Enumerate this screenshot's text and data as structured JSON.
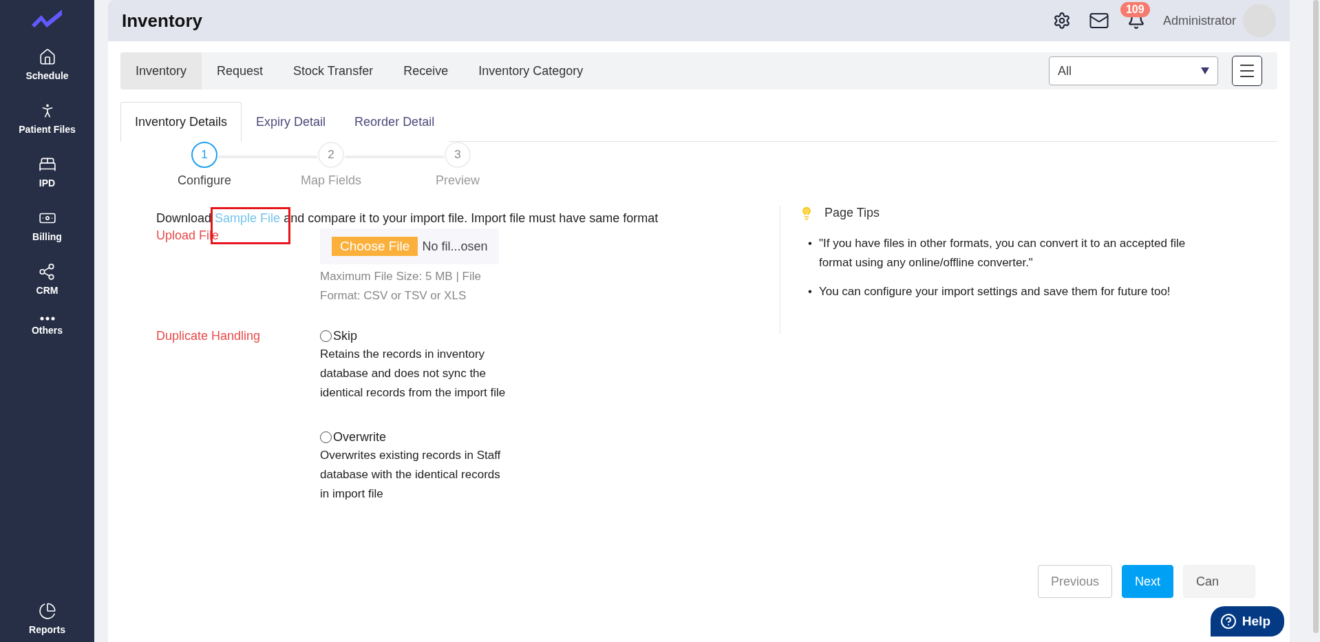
{
  "sidebar": {
    "items": [
      {
        "label": "Schedule",
        "kind": "home"
      },
      {
        "label": "Patient Files",
        "kind": "person"
      },
      {
        "label": "IPD",
        "kind": "bed"
      },
      {
        "label": "Billing",
        "kind": "cash"
      },
      {
        "label": "CRM",
        "kind": "network"
      },
      {
        "label": "Others",
        "kind": "dots"
      }
    ],
    "footer": {
      "label": "Reports",
      "kind": "pie"
    }
  },
  "header": {
    "title": "Inventory",
    "notification_count": "109",
    "user": "Administrator"
  },
  "tabs": [
    {
      "label": "Inventory",
      "selected": true
    },
    {
      "label": "Request",
      "selected": false
    },
    {
      "label": "Stock Transfer",
      "selected": false
    },
    {
      "label": "Receive",
      "selected": false
    },
    {
      "label": "Inventory Category",
      "selected": false
    }
  ],
  "filter": {
    "value": "All"
  },
  "subtabs": [
    {
      "label": "Inventory Details",
      "selected": true
    },
    {
      "label": "Expiry Detail",
      "selected": false
    },
    {
      "label": "Reorder Detail",
      "selected": false
    }
  ],
  "steps": [
    {
      "number": "1",
      "label": "Configure",
      "selected": true
    },
    {
      "number": "2",
      "label": "Map Fields",
      "selected": false
    },
    {
      "number": "3",
      "label": "Preview",
      "selected": false
    }
  ],
  "download": {
    "before": "Download",
    "link": "Sample File",
    "after": "and compare it to your import file. Import file must have same format",
    "highlighted": true
  },
  "upload": {
    "label": "Upload File",
    "button": "Choose File",
    "status": "No fil...osen",
    "hint": "Maximum File Size: 5 MB | File Format: CSV or TSV or XLS"
  },
  "duplicate": {
    "label": "Duplicate Handling",
    "options": [
      {
        "label": "Skip",
        "description": "Retains the records in inventory database and does not sync the identical records from the import file",
        "selected": false
      },
      {
        "label": "Overwrite",
        "description": "Overwrites existing records in Staff database with the identical records in import file",
        "selected": false
      }
    ]
  },
  "tips": {
    "title": "Page Tips",
    "marker": "•",
    "items": [
      "\"If you have files in other formats, you can convert it to an accepted file format using any online/offline converter.\"",
      "You can configure your import settings and save them for future too!"
    ]
  },
  "buttons": [
    {
      "label": "Previous",
      "kind": "outline"
    },
    {
      "label": "Next",
      "kind": "primary"
    },
    {
      "label": "Can",
      "kind": "muted"
    }
  ],
  "help": {
    "label": "Help"
  }
}
